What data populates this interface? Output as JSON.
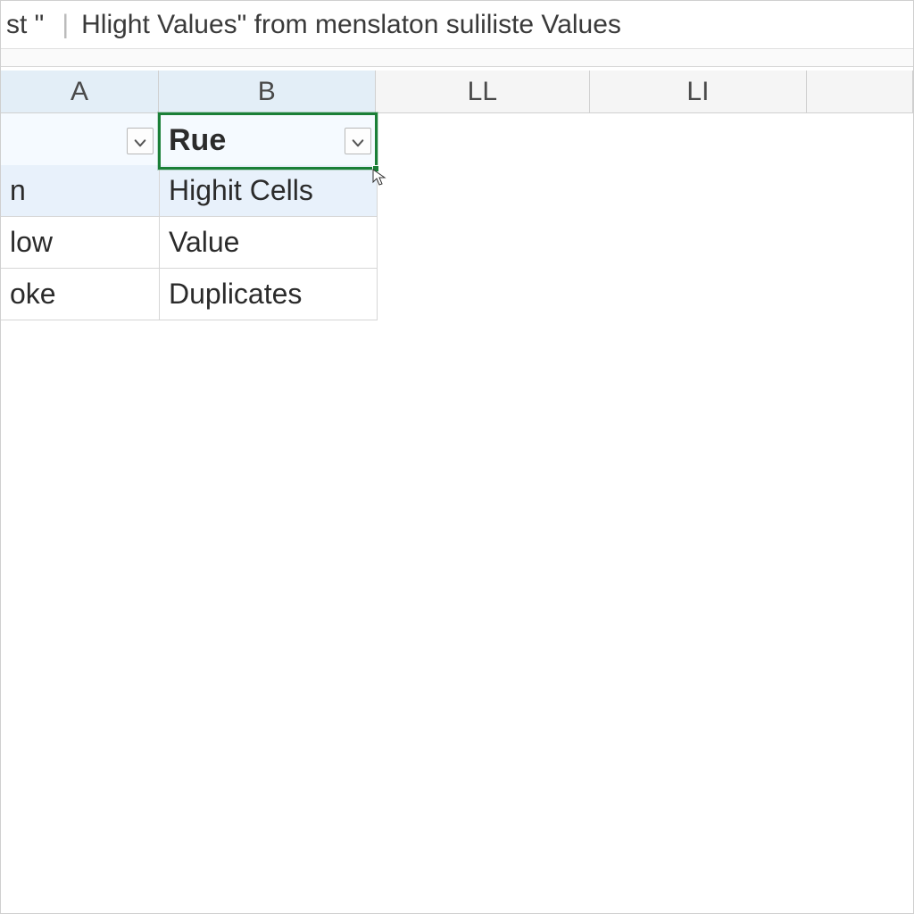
{
  "title": {
    "segment_left": "st \"",
    "divider": "|",
    "segment_right": "Hlight Values\" from menslaton suliliste Values"
  },
  "columns": {
    "A": "A",
    "B": "B",
    "LL": "LL",
    "LI": "LI"
  },
  "filter_row": {
    "A": "",
    "B": "Rue"
  },
  "data": {
    "r1": {
      "A": "n",
      "B": "Highit Cells"
    },
    "r2": {
      "A": "low",
      "B": "Value"
    },
    "r3": {
      "A": "oke",
      "B": "Duplicates"
    }
  }
}
